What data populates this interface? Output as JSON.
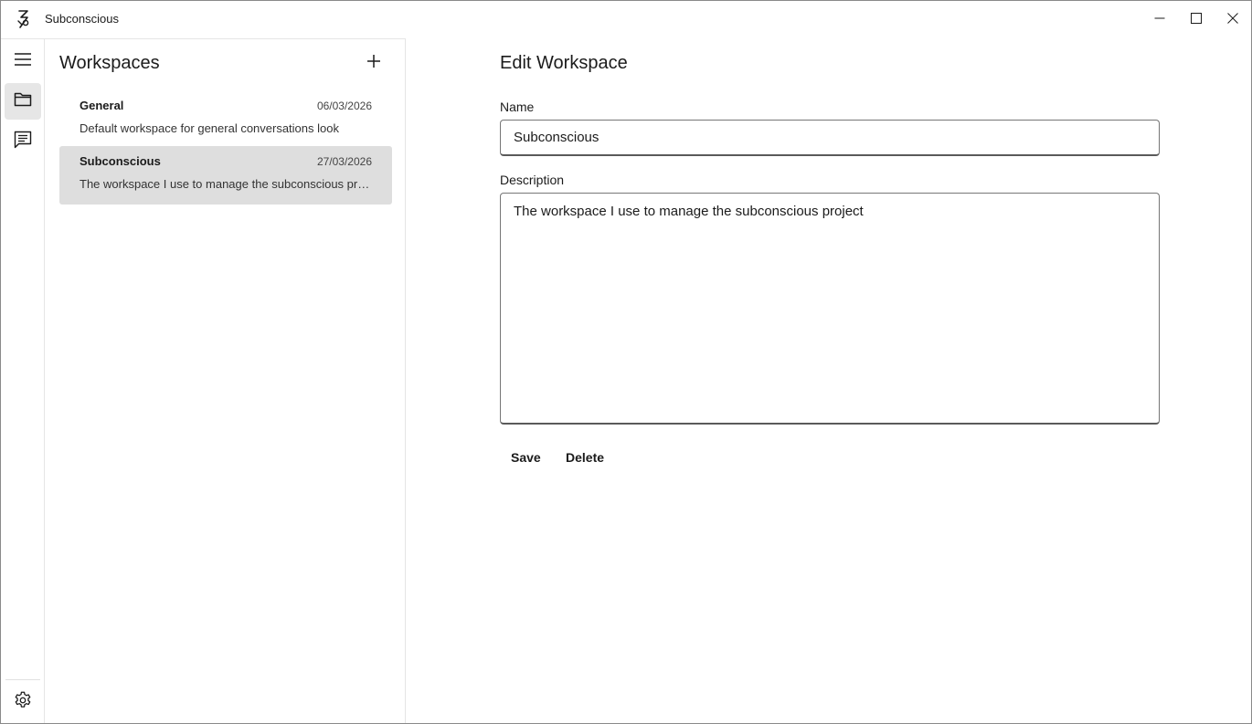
{
  "window": {
    "title": "Subconscious"
  },
  "icons": {
    "app": "subconscious-logo-icon",
    "minimize": "minimize-icon",
    "maximize": "maximize-icon",
    "close": "close-icon",
    "menu": "hamburger-menu-icon",
    "folder": "folder-icon",
    "chat": "chat-icon",
    "settings": "gear-icon",
    "add": "plus-icon"
  },
  "workspaces": {
    "title": "Workspaces",
    "items": [
      {
        "name": "General",
        "date": "06/03/2026",
        "description": "Default workspace for general conversations look",
        "selected": false
      },
      {
        "name": "Subconscious",
        "date": "27/03/2026",
        "description": "The workspace I use to manage the subconscious project",
        "selected": true
      }
    ]
  },
  "edit_form": {
    "title": "Edit Workspace",
    "name_label": "Name",
    "name_value": "Subconscious",
    "description_label": "Description",
    "description_value": "The workspace I use to manage the subconscious project",
    "save_label": "Save",
    "delete_label": "Delete"
  },
  "colors": {
    "selected_item": "#dedede",
    "rail_active": "#e6e6e6",
    "border": "#e5e5e5"
  }
}
